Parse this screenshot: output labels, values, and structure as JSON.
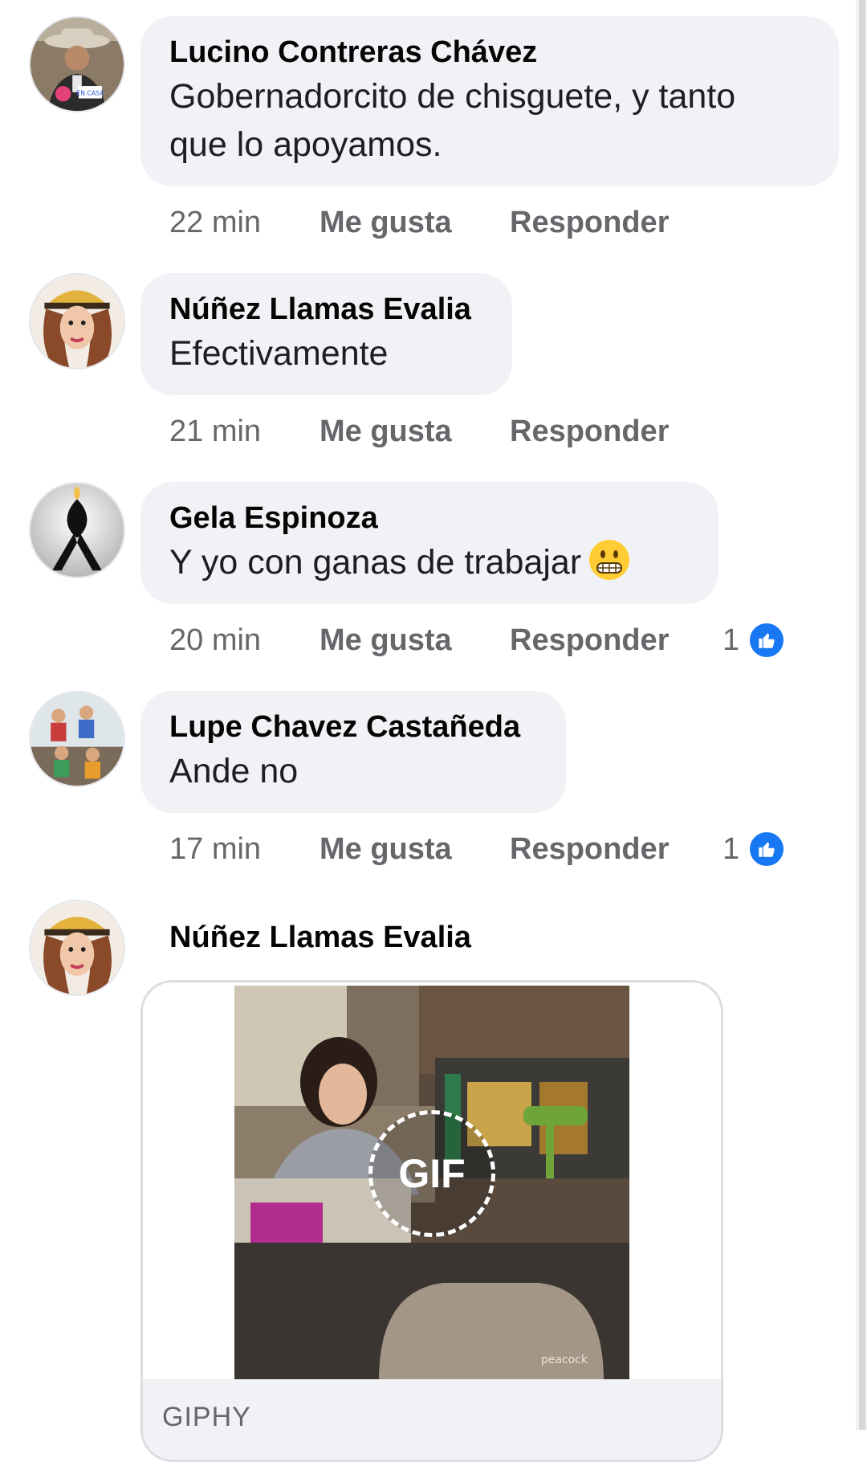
{
  "comments": [
    {
      "author": "Lucino Contreras Chávez",
      "text_line1": "Gobernadorcito de chisguete, y tanto",
      "text_line2": "que lo apoyamos.",
      "time": "22 min",
      "like_label": "Me gusta",
      "reply_label": "Responder",
      "avatar_badge": "EN CASA"
    },
    {
      "author": "Núñez Llamas Evalia",
      "text": "Efectivamente",
      "time": "21 min",
      "like_label": "Me gusta",
      "reply_label": "Responder"
    },
    {
      "author": "Gela Espinoza",
      "text": "Y yo con ganas de trabajar",
      "emoji": "grimacing-face-emoji",
      "time": "20 min",
      "like_label": "Me gusta",
      "reply_label": "Responder",
      "reaction_count": "1",
      "reaction_icon": "thumbs-up-icon"
    },
    {
      "author": "Lupe Chavez Castañeda",
      "text": "Ande no",
      "time": "17 min",
      "like_label": "Me gusta",
      "reply_label": "Responder",
      "reaction_count": "1",
      "reaction_icon": "thumbs-up-icon"
    },
    {
      "author": "Núñez Llamas Evalia",
      "gif_label": "GIF",
      "gif_watermark": "peacock",
      "gif_source": "GIPHY"
    }
  ],
  "colors": {
    "bubble_bg": "#f0f2f5",
    "meta_text": "#65676b",
    "like_blue": "#1877f2"
  }
}
